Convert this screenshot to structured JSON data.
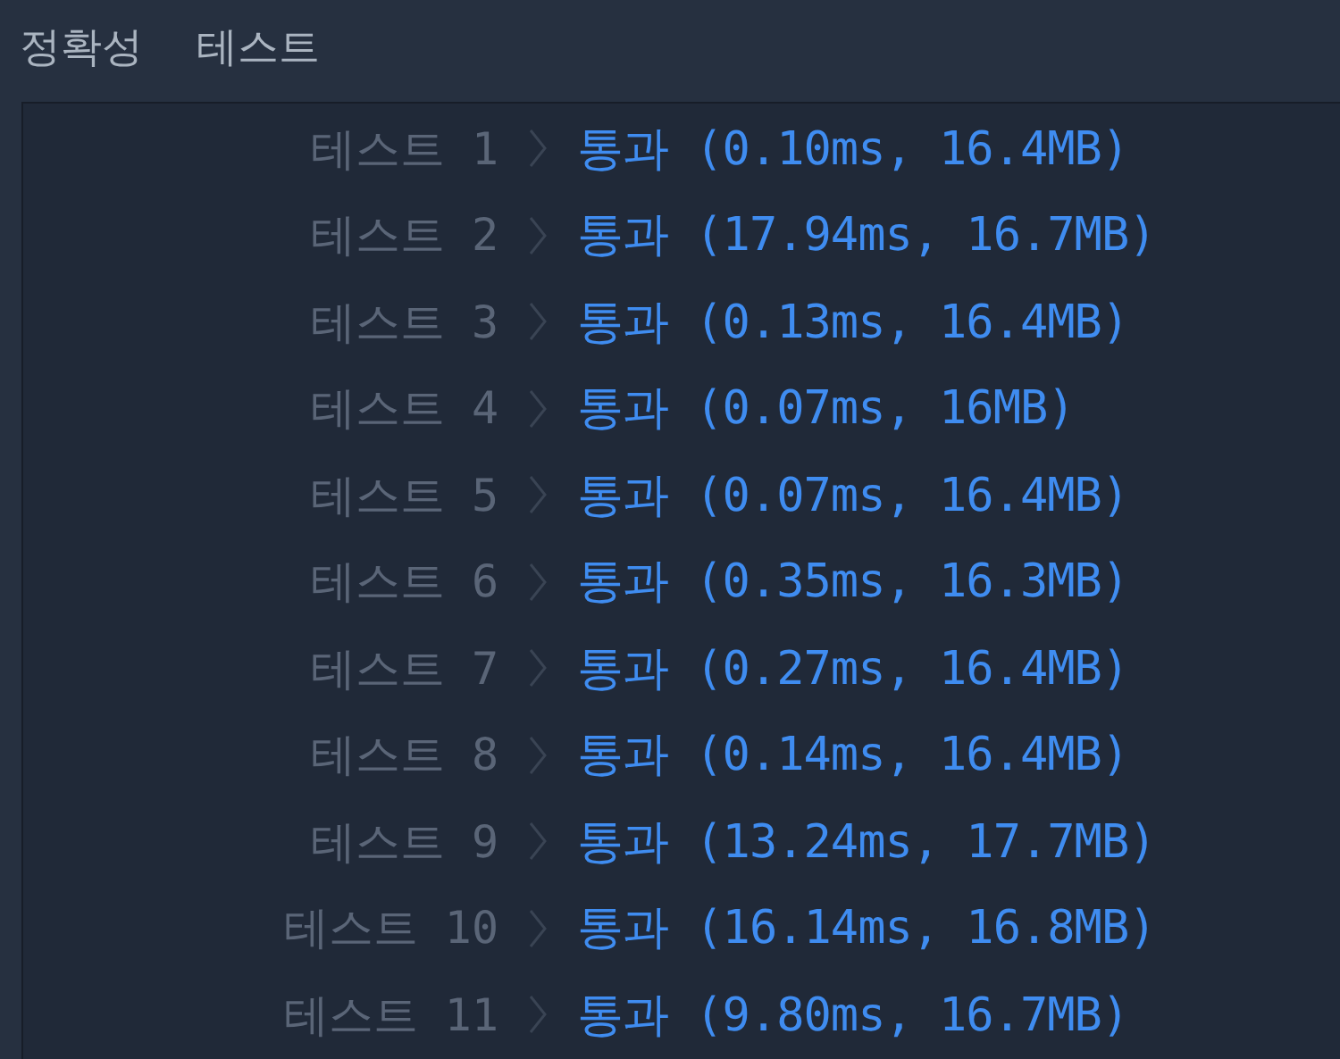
{
  "tabs": [
    "정확성",
    "테스트"
  ],
  "results": [
    {
      "label": "테스트 1",
      "result": "통과 (0.10ms, 16.4MB)"
    },
    {
      "label": "테스트 2",
      "result": "통과 (17.94ms, 16.7MB)"
    },
    {
      "label": "테스트 3",
      "result": "통과 (0.13ms, 16.4MB)"
    },
    {
      "label": "테스트 4",
      "result": "통과 (0.07ms, 16MB)"
    },
    {
      "label": "테스트 5",
      "result": "통과 (0.07ms, 16.4MB)"
    },
    {
      "label": "테스트 6",
      "result": "통과 (0.35ms, 16.3MB)"
    },
    {
      "label": "테스트 7",
      "result": "통과 (0.27ms, 16.4MB)"
    },
    {
      "label": "테스트 8",
      "result": "통과 (0.14ms, 16.4MB)"
    },
    {
      "label": "테스트 9",
      "result": "통과 (13.24ms, 17.7MB)"
    },
    {
      "label": "테스트 10",
      "result": "통과 (16.14ms, 16.8MB)"
    },
    {
      "label": "테스트 11",
      "result": "통과 (9.80ms, 16.7MB)"
    }
  ]
}
